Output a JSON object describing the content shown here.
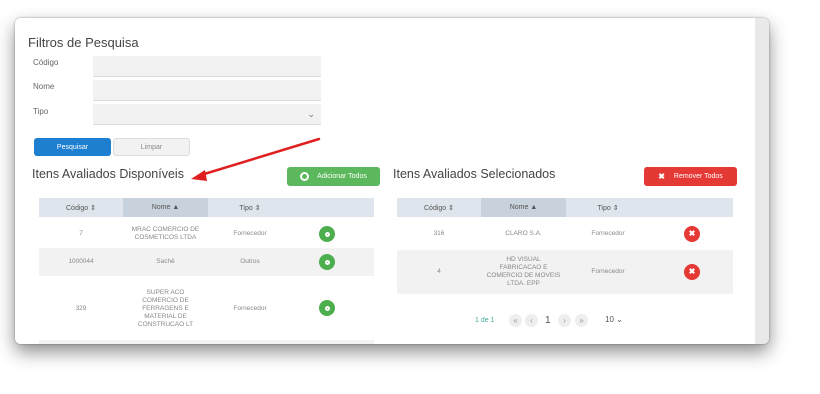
{
  "filters": {
    "title": "Filtros de Pesquisa",
    "codigo_label": "Código",
    "codigo_value": "",
    "nome_label": "Nome",
    "nome_value": "",
    "tipo_label": "Tipo",
    "tipo_value": "",
    "pesquisar_label": "Pesquisar",
    "limpar_label": "Limpar"
  },
  "available": {
    "title": "Itens Avaliados Disponíveis",
    "add_all_label": "Adicionar Todos",
    "columns": [
      "Código ⇕",
      "Nome ▲",
      "Tipo ⇕"
    ],
    "rows": [
      {
        "codigo": "7",
        "nome": "MRAC COMERCIO DE COSMETICOS LTDA",
        "tipo": "Fornecedor"
      },
      {
        "codigo": "1000044",
        "nome": "Sachê",
        "tipo": "Outros"
      },
      {
        "codigo": "329",
        "nome": "SUPER ACO COMERCIO DE FERRAGENS E MATERIAL DE CONSTRUCAO LT",
        "tipo": "Fornecedor"
      }
    ]
  },
  "selected": {
    "title": "Itens Avaliados Selecionados",
    "remove_all_label": "Remover Todos",
    "columns": [
      "Código ⇕",
      "Nome ▲",
      "Tipo ⇕"
    ],
    "rows": [
      {
        "codigo": "316",
        "nome": "CLARO S.A.",
        "tipo": "Fornecedor"
      },
      {
        "codigo": "4",
        "nome": "HD VISUAL FABRICACAO E COMERCIO DE MOVEIS LTDA. EPP",
        "tipo": "Fornecedor"
      }
    ],
    "pagination": {
      "info": "1 de 1",
      "page": "1",
      "per_page": "10 ⌄"
    }
  },
  "colors": {
    "primary": "#1e7fd0",
    "success": "#4cae4c",
    "danger": "#e53935",
    "annotation": "#e02020"
  }
}
